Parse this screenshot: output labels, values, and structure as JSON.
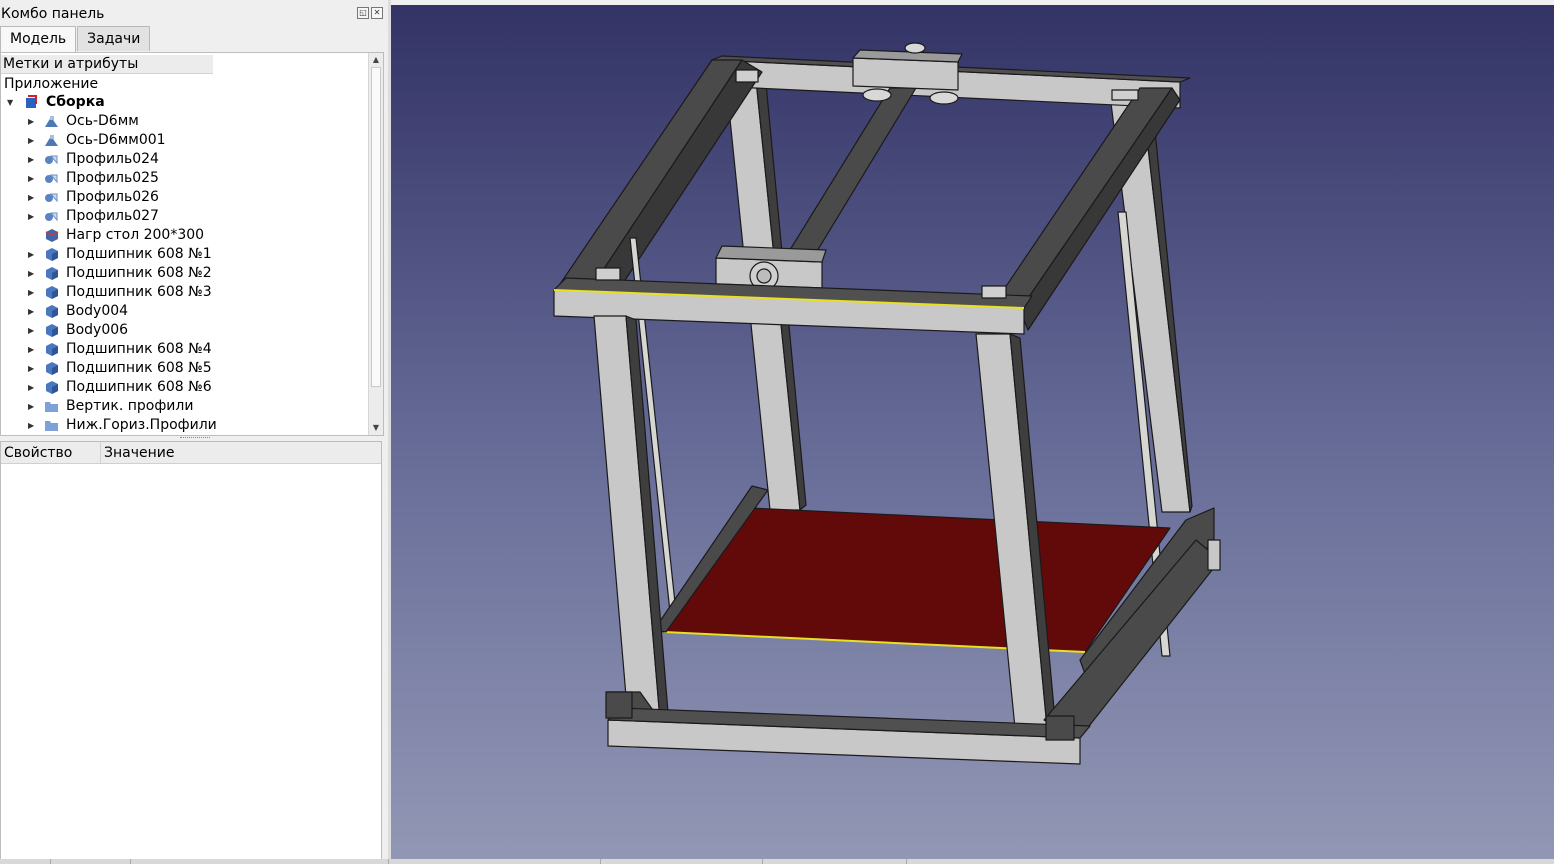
{
  "combo": {
    "title": "Комбо панель",
    "tabs": [
      {
        "label": "Модель",
        "active": true
      },
      {
        "label": "Задачи",
        "active": false
      }
    ]
  },
  "tree": {
    "header": "Метки и атрибуты",
    "app_label": "Приложение",
    "root": {
      "label": "Сборка",
      "icon": "assembly-icon"
    },
    "items": [
      {
        "label": "Ось-D6мм",
        "icon": "part-blue-icon"
      },
      {
        "label": "Ось-D6мм001",
        "icon": "part-blue-icon"
      },
      {
        "label": "Профиль024",
        "icon": "link-icon"
      },
      {
        "label": "Профиль025",
        "icon": "link-icon"
      },
      {
        "label": "Профиль026",
        "icon": "link-icon"
      },
      {
        "label": "Профиль027",
        "icon": "link-icon"
      },
      {
        "label": "Нагр стол 200*300",
        "icon": "cube-icon"
      },
      {
        "label": "Подшипник 608 №1",
        "icon": "body-icon"
      },
      {
        "label": "Подшипник 608 №2",
        "icon": "body-icon"
      },
      {
        "label": "Подшипник 608 №3",
        "icon": "body-icon"
      },
      {
        "label": "Body004",
        "icon": "body-icon"
      },
      {
        "label": "Body006",
        "icon": "body-icon"
      },
      {
        "label": "Подшипник 608 №4",
        "icon": "body-icon"
      },
      {
        "label": "Подшипник 608 №5",
        "icon": "body-icon"
      },
      {
        "label": "Подшипник 608 №6",
        "icon": "body-icon"
      },
      {
        "label": "Вертик. профили",
        "icon": "folder-icon"
      },
      {
        "label": "Ниж.Гориз.Профили",
        "icon": "folder-icon"
      }
    ]
  },
  "properties": {
    "col_property": "Свойство",
    "col_value": "Значение"
  },
  "colors": {
    "bg_top": "#333366",
    "bg_bottom": "#9297b5",
    "profile_light": "#cacaca",
    "profile_dark": "#4c4c4c",
    "heatbed": "#620a0a",
    "highlight": "#e8e020"
  }
}
